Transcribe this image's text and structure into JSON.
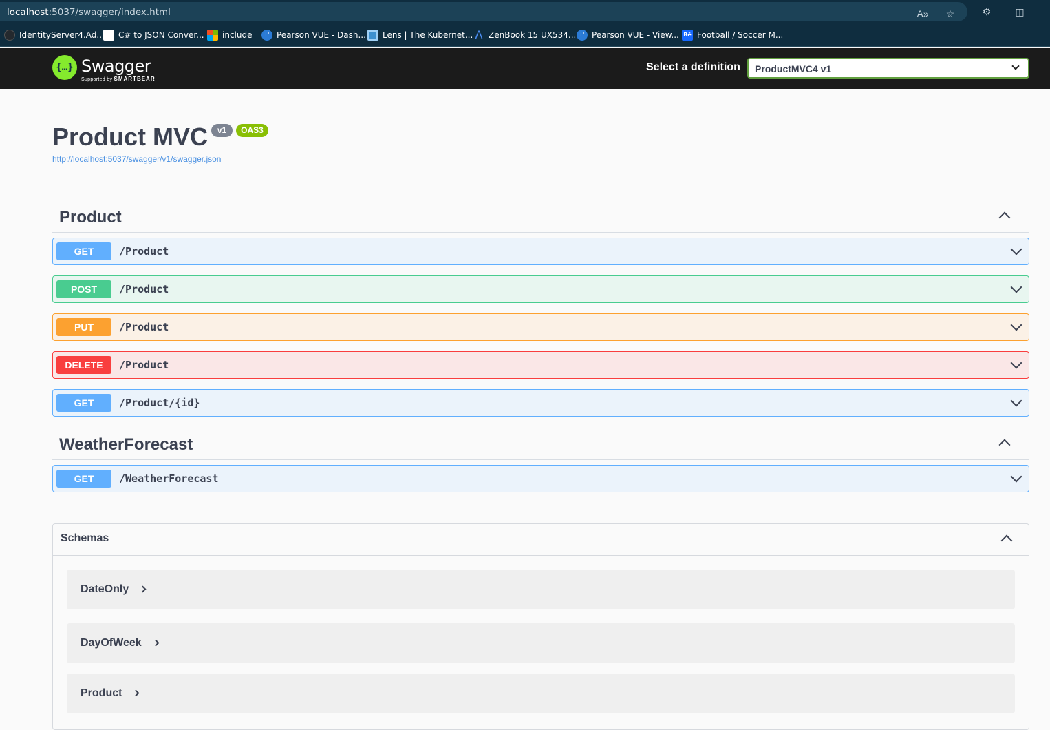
{
  "browser": {
    "url_host": "localhost",
    "url_path": ":5037/swagger/index.html",
    "bookmarks": [
      {
        "label": "IdentityServer4.Ad...",
        "icon": "github-icon",
        "color": "#24292e"
      },
      {
        "label": "C# to JSON Conver...",
        "icon": "white-square-icon",
        "color": "#ffffff"
      },
      {
        "label": "include",
        "icon": "microsoft-icon",
        "color": "#f25022"
      },
      {
        "label": "Pearson VUE - Dash...",
        "icon": "pearson-icon",
        "color": "#2b7bd6"
      },
      {
        "label": "Lens | The Kubernet...",
        "icon": "lens-icon",
        "color": "#3d90ce"
      },
      {
        "label": "ZenBook 15 UX534...",
        "icon": "asus-icon",
        "color": "#2b7bd6"
      },
      {
        "label": "Pearson VUE - View...",
        "icon": "pearson-icon",
        "color": "#2b7bd6"
      },
      {
        "label": "Football / Soccer M...",
        "icon": "behance-icon",
        "color": "#1769ff"
      }
    ]
  },
  "topbar": {
    "logo_name": "Swagger",
    "logo_sub_prefix": "Supported by",
    "logo_sub_brand": "SMARTBEAR",
    "definition_label": "Select a definition",
    "definition_value": "ProductMVC4 v1"
  },
  "info": {
    "title": "Product MVC",
    "version_badge": "v1",
    "oas_badge": "OAS3",
    "spec_link": "http://localhost:5037/swagger/v1/swagger.json"
  },
  "tags": [
    {
      "name": "Product",
      "operations": [
        {
          "method": "GET",
          "path": "/Product"
        },
        {
          "method": "POST",
          "path": "/Product"
        },
        {
          "method": "PUT",
          "path": "/Product"
        },
        {
          "method": "DELETE",
          "path": "/Product"
        },
        {
          "method": "GET",
          "path": "/Product/{id}"
        }
      ]
    },
    {
      "name": "WeatherForecast",
      "operations": [
        {
          "method": "GET",
          "path": "/WeatherForecast"
        }
      ]
    }
  ],
  "schemas": {
    "title": "Schemas",
    "models": [
      "DateOnly",
      "DayOfWeek",
      "Product"
    ]
  },
  "colors": {
    "get": "#61affe",
    "post": "#49cc90",
    "put": "#fca130",
    "delete": "#f93e3e",
    "swagger_green": "#85ea2d",
    "topbar": "#1b1b1b"
  }
}
